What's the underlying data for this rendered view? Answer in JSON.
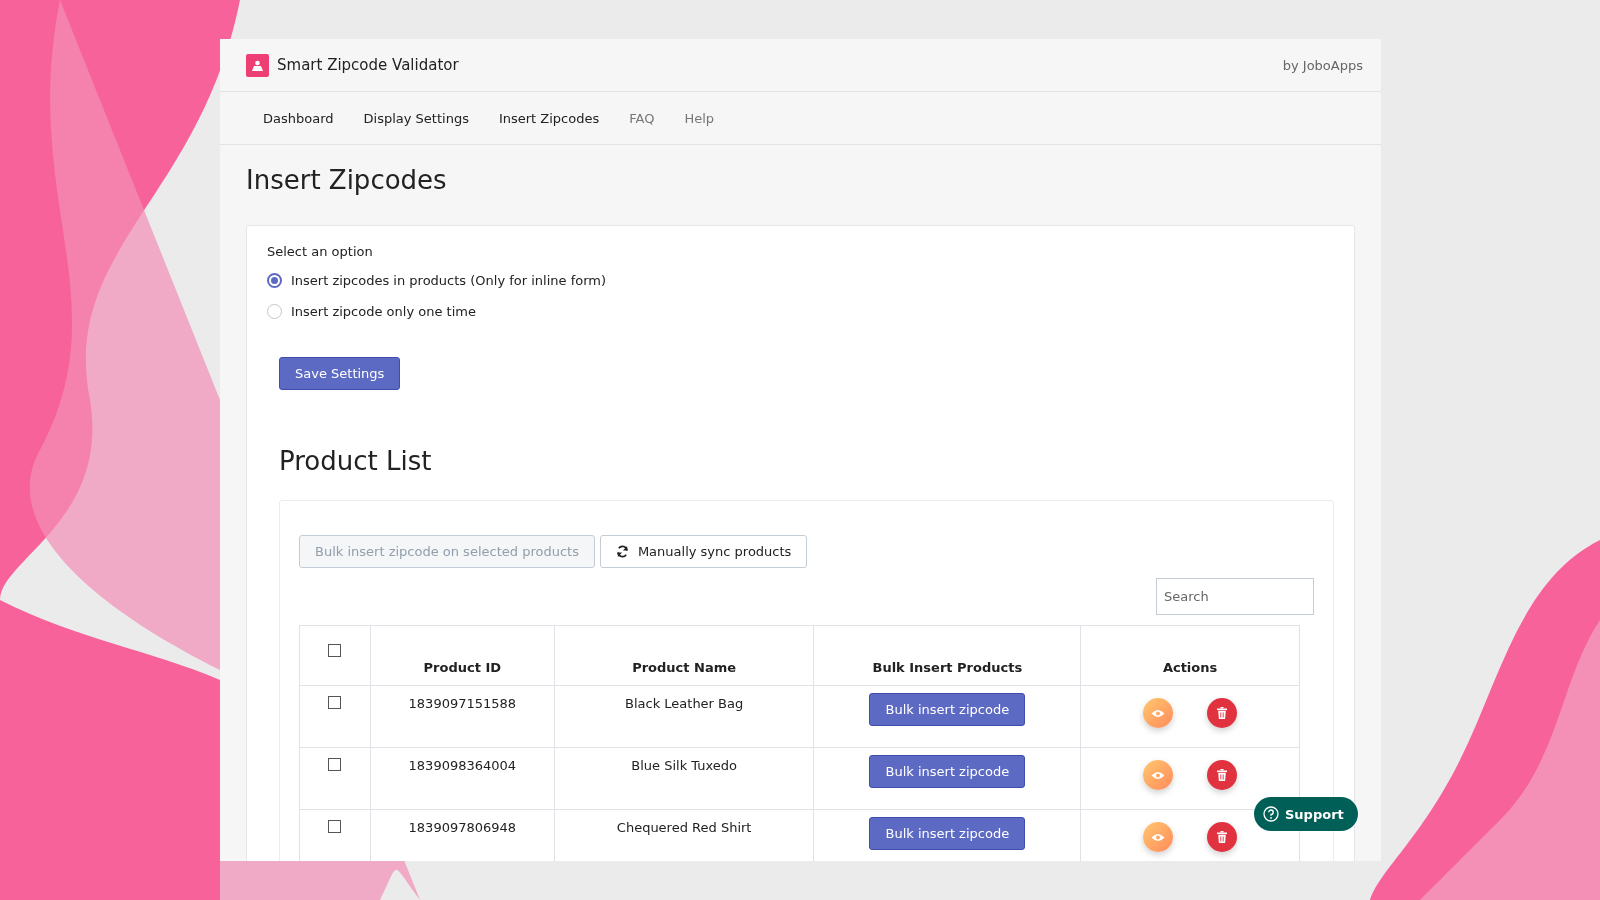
{
  "app": {
    "title": "Smart Zipcode Validator",
    "vendor": "by JoboApps"
  },
  "nav": [
    {
      "label": "Dashboard",
      "muted": false
    },
    {
      "label": "Display Settings",
      "muted": false
    },
    {
      "label": "Insert Zipcodes",
      "muted": false
    },
    {
      "label": "FAQ",
      "muted": true
    },
    {
      "label": "Help",
      "muted": true
    }
  ],
  "page_title": "Insert Zipcodes",
  "options": {
    "label": "Select an option",
    "radios": [
      {
        "label": "Insert zipcodes in products (Only for inline form)",
        "selected": true
      },
      {
        "label": "Insert zipcode only one time",
        "selected": false
      }
    ],
    "save_button": "Save Settings"
  },
  "product_list": {
    "title": "Product List",
    "toolbar": [
      {
        "label": "Bulk insert zipcode on selected products",
        "disabled": true
      },
      {
        "label": "Manually sync products",
        "disabled": false
      }
    ],
    "search": {
      "placeholder": "Search"
    },
    "columns": [
      {
        "label": "Product ID"
      },
      {
        "label": "Product Name"
      },
      {
        "label": "Bulk Insert Products"
      },
      {
        "label": "Actions"
      }
    ],
    "header_checked": false,
    "rows": [
      {
        "checked": false,
        "id": "1839097151588",
        "name": "Black Leather Bag",
        "button": "Bulk insert zipcode"
      },
      {
        "checked": false,
        "id": "1839098364004",
        "name": "Blue Silk Tuxedo",
        "button": "Bulk insert zipcode"
      },
      {
        "checked": false,
        "id": "1839097806948",
        "name": "Chequered Red Shirt",
        "button": "Bulk insert zipcode"
      }
    ]
  },
  "support_button": "Support"
}
